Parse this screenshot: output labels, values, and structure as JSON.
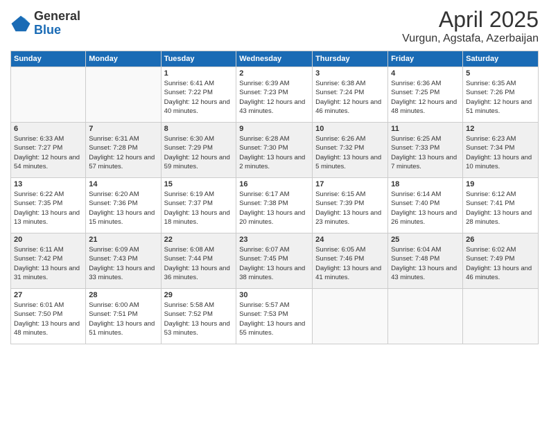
{
  "header": {
    "logo": {
      "general": "General",
      "blue": "Blue"
    },
    "title": "April 2025",
    "location": "Vurgun, Agstafa, Azerbaijan"
  },
  "days_of_week": [
    "Sunday",
    "Monday",
    "Tuesday",
    "Wednesday",
    "Thursday",
    "Friday",
    "Saturday"
  ],
  "weeks": [
    [
      {
        "day": "",
        "info": ""
      },
      {
        "day": "",
        "info": ""
      },
      {
        "day": "1",
        "info": "Sunrise: 6:41 AM\nSunset: 7:22 PM\nDaylight: 12 hours and 40 minutes."
      },
      {
        "day": "2",
        "info": "Sunrise: 6:39 AM\nSunset: 7:23 PM\nDaylight: 12 hours and 43 minutes."
      },
      {
        "day": "3",
        "info": "Sunrise: 6:38 AM\nSunset: 7:24 PM\nDaylight: 12 hours and 46 minutes."
      },
      {
        "day": "4",
        "info": "Sunrise: 6:36 AM\nSunset: 7:25 PM\nDaylight: 12 hours and 48 minutes."
      },
      {
        "day": "5",
        "info": "Sunrise: 6:35 AM\nSunset: 7:26 PM\nDaylight: 12 hours and 51 minutes."
      }
    ],
    [
      {
        "day": "6",
        "info": "Sunrise: 6:33 AM\nSunset: 7:27 PM\nDaylight: 12 hours and 54 minutes."
      },
      {
        "day": "7",
        "info": "Sunrise: 6:31 AM\nSunset: 7:28 PM\nDaylight: 12 hours and 57 minutes."
      },
      {
        "day": "8",
        "info": "Sunrise: 6:30 AM\nSunset: 7:29 PM\nDaylight: 12 hours and 59 minutes."
      },
      {
        "day": "9",
        "info": "Sunrise: 6:28 AM\nSunset: 7:30 PM\nDaylight: 13 hours and 2 minutes."
      },
      {
        "day": "10",
        "info": "Sunrise: 6:26 AM\nSunset: 7:32 PM\nDaylight: 13 hours and 5 minutes."
      },
      {
        "day": "11",
        "info": "Sunrise: 6:25 AM\nSunset: 7:33 PM\nDaylight: 13 hours and 7 minutes."
      },
      {
        "day": "12",
        "info": "Sunrise: 6:23 AM\nSunset: 7:34 PM\nDaylight: 13 hours and 10 minutes."
      }
    ],
    [
      {
        "day": "13",
        "info": "Sunrise: 6:22 AM\nSunset: 7:35 PM\nDaylight: 13 hours and 13 minutes."
      },
      {
        "day": "14",
        "info": "Sunrise: 6:20 AM\nSunset: 7:36 PM\nDaylight: 13 hours and 15 minutes."
      },
      {
        "day": "15",
        "info": "Sunrise: 6:19 AM\nSunset: 7:37 PM\nDaylight: 13 hours and 18 minutes."
      },
      {
        "day": "16",
        "info": "Sunrise: 6:17 AM\nSunset: 7:38 PM\nDaylight: 13 hours and 20 minutes."
      },
      {
        "day": "17",
        "info": "Sunrise: 6:15 AM\nSunset: 7:39 PM\nDaylight: 13 hours and 23 minutes."
      },
      {
        "day": "18",
        "info": "Sunrise: 6:14 AM\nSunset: 7:40 PM\nDaylight: 13 hours and 26 minutes."
      },
      {
        "day": "19",
        "info": "Sunrise: 6:12 AM\nSunset: 7:41 PM\nDaylight: 13 hours and 28 minutes."
      }
    ],
    [
      {
        "day": "20",
        "info": "Sunrise: 6:11 AM\nSunset: 7:42 PM\nDaylight: 13 hours and 31 minutes."
      },
      {
        "day": "21",
        "info": "Sunrise: 6:09 AM\nSunset: 7:43 PM\nDaylight: 13 hours and 33 minutes."
      },
      {
        "day": "22",
        "info": "Sunrise: 6:08 AM\nSunset: 7:44 PM\nDaylight: 13 hours and 36 minutes."
      },
      {
        "day": "23",
        "info": "Sunrise: 6:07 AM\nSunset: 7:45 PM\nDaylight: 13 hours and 38 minutes."
      },
      {
        "day": "24",
        "info": "Sunrise: 6:05 AM\nSunset: 7:46 PM\nDaylight: 13 hours and 41 minutes."
      },
      {
        "day": "25",
        "info": "Sunrise: 6:04 AM\nSunset: 7:48 PM\nDaylight: 13 hours and 43 minutes."
      },
      {
        "day": "26",
        "info": "Sunrise: 6:02 AM\nSunset: 7:49 PM\nDaylight: 13 hours and 46 minutes."
      }
    ],
    [
      {
        "day": "27",
        "info": "Sunrise: 6:01 AM\nSunset: 7:50 PM\nDaylight: 13 hours and 48 minutes."
      },
      {
        "day": "28",
        "info": "Sunrise: 6:00 AM\nSunset: 7:51 PM\nDaylight: 13 hours and 51 minutes."
      },
      {
        "day": "29",
        "info": "Sunrise: 5:58 AM\nSunset: 7:52 PM\nDaylight: 13 hours and 53 minutes."
      },
      {
        "day": "30",
        "info": "Sunrise: 5:57 AM\nSunset: 7:53 PM\nDaylight: 13 hours and 55 minutes."
      },
      {
        "day": "",
        "info": ""
      },
      {
        "day": "",
        "info": ""
      },
      {
        "day": "",
        "info": ""
      }
    ]
  ]
}
